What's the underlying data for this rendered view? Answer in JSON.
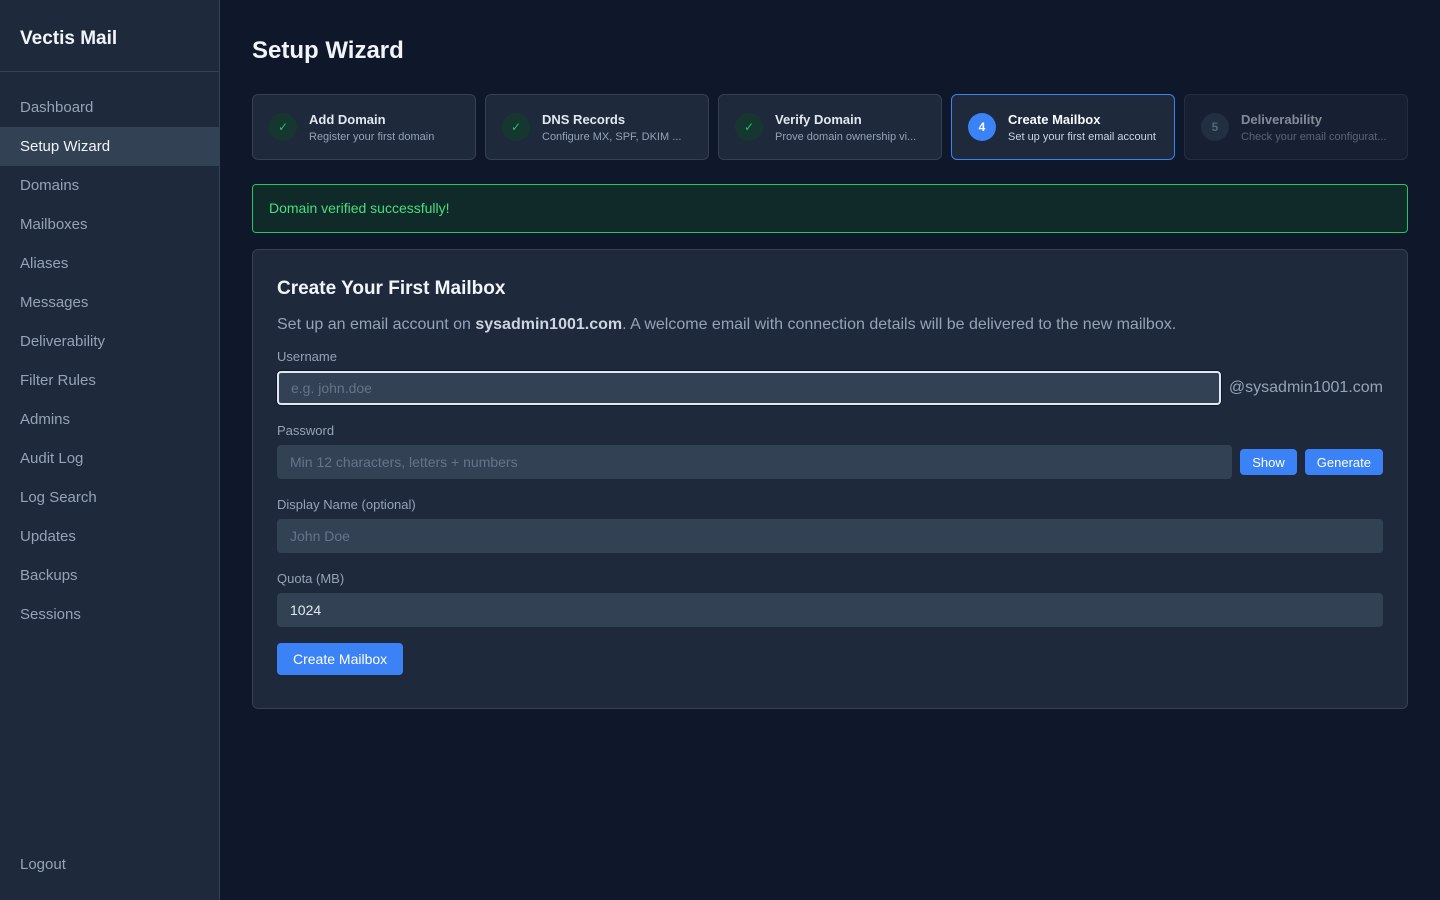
{
  "app": {
    "brand": "Vectis Mail"
  },
  "sidebar": {
    "items": [
      {
        "label": "Dashboard"
      },
      {
        "label": "Setup Wizard"
      },
      {
        "label": "Domains"
      },
      {
        "label": "Mailboxes"
      },
      {
        "label": "Aliases"
      },
      {
        "label": "Messages"
      },
      {
        "label": "Deliverability"
      },
      {
        "label": "Filter Rules"
      },
      {
        "label": "Admins"
      },
      {
        "label": "Audit Log"
      },
      {
        "label": "Log Search"
      },
      {
        "label": "Updates"
      },
      {
        "label": "Backups"
      },
      {
        "label": "Sessions"
      }
    ],
    "active_index": 1,
    "logout": "Logout"
  },
  "page": {
    "title": "Setup Wizard"
  },
  "steps": [
    {
      "marker": "✓",
      "title": "Add Domain",
      "subtitle": "Register your first domain",
      "state": "done"
    },
    {
      "marker": "✓",
      "title": "DNS Records",
      "subtitle": "Configure MX, SPF, DKIM ...",
      "state": "done"
    },
    {
      "marker": "✓",
      "title": "Verify Domain",
      "subtitle": "Prove domain ownership vi...",
      "state": "done"
    },
    {
      "marker": "4",
      "title": "Create Mailbox",
      "subtitle": "Set up your first email account",
      "state": "current"
    },
    {
      "marker": "5",
      "title": "Deliverability",
      "subtitle": "Check your email configurat...",
      "state": "pending"
    }
  ],
  "alert": {
    "message": "Domain verified successfully!",
    "color": "#22c55e"
  },
  "form": {
    "title": "Create Your First Mailbox",
    "desc_prefix": "Set up an email account on ",
    "desc_domain": "sysadmin1001.com",
    "desc_suffix": ". A welcome email with connection details will be delivered to the new mailbox.",
    "username": {
      "label": "Username",
      "placeholder": "e.g. john.doe",
      "value": "",
      "suffix": "@sysadmin1001.com"
    },
    "password": {
      "label": "Password",
      "placeholder": "Min 12 characters, letters + numbers",
      "value": "",
      "show_label": "Show",
      "generate_label": "Generate"
    },
    "display_name": {
      "label": "Display Name (optional)",
      "placeholder": "John Doe",
      "value": ""
    },
    "quota": {
      "label": "Quota (MB)",
      "value": "1024"
    },
    "submit_label": "Create Mailbox"
  },
  "colors": {
    "accent": "#3b82f6",
    "success": "#22c55e",
    "background": "#0f172a",
    "surface": "#1e293b"
  }
}
